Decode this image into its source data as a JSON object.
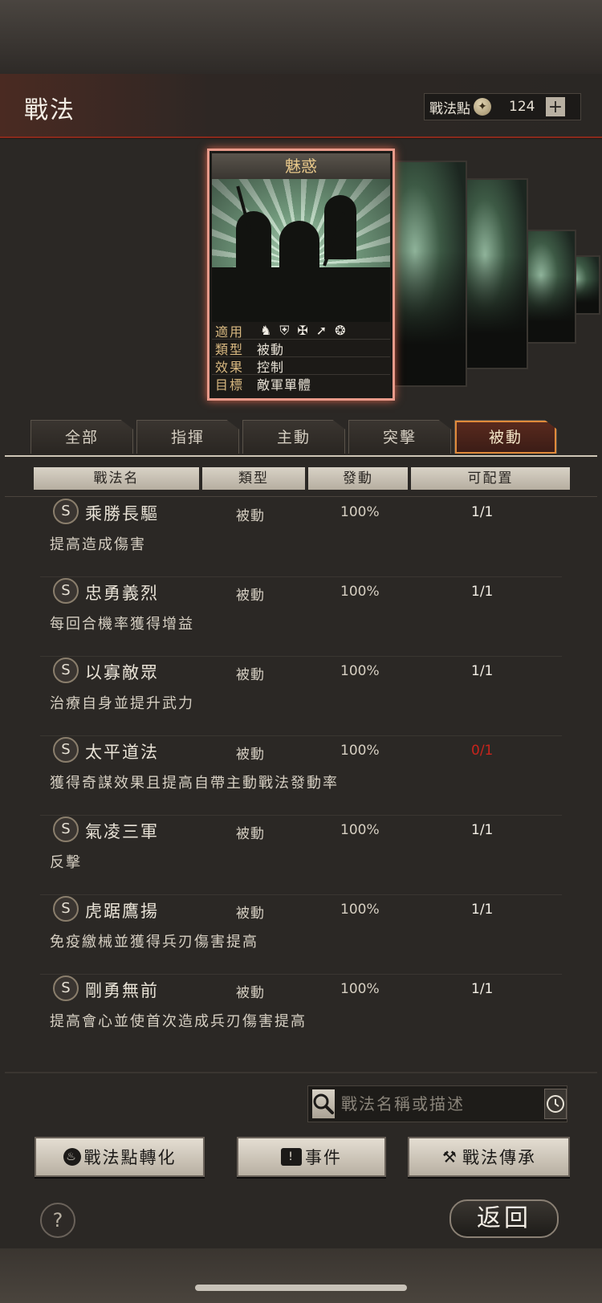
{
  "header": {
    "title": "戰法"
  },
  "points": {
    "label": "戰法點",
    "coin_icon": "coin-icon",
    "value": "124",
    "plus": "+"
  },
  "card": {
    "name": "魅惑",
    "props": [
      {
        "key": "適用",
        "value": ""
      },
      {
        "key": "類型",
        "value": "被動"
      },
      {
        "key": "效果",
        "value": "控制"
      },
      {
        "key": "目標",
        "value": "敵軍單體"
      }
    ],
    "unit_icons": [
      "cavalry-icon",
      "shield-icon",
      "bow-icon",
      "spear-icon",
      "siege-icon"
    ]
  },
  "tabs": [
    "全部",
    "指揮",
    "主動",
    "突擊",
    "被動"
  ],
  "active_tab": "被動",
  "columns": [
    "戰法名",
    "類型",
    "發動",
    "可配置"
  ],
  "tactics": [
    {
      "grade": "S",
      "name": "乘勝長驅",
      "type": "被動",
      "rate": "100%",
      "slots": "1/1",
      "desc": "提高造成傷害"
    },
    {
      "grade": "S",
      "name": "忠勇義烈",
      "type": "被動",
      "rate": "100%",
      "slots": "1/1",
      "desc": "每回合機率獲得增益"
    },
    {
      "grade": "S",
      "name": "以寡敵眾",
      "type": "被動",
      "rate": "100%",
      "slots": "1/1",
      "desc": "治療自身並提升武力"
    },
    {
      "grade": "S",
      "name": "太平道法",
      "type": "被動",
      "rate": "100%",
      "slots": "0/1",
      "desc": "獲得奇謀效果且提高自帶主動戰法發動率"
    },
    {
      "grade": "S",
      "name": "氣凌三軍",
      "type": "被動",
      "rate": "100%",
      "slots": "1/1",
      "desc": "反擊"
    },
    {
      "grade": "S",
      "name": "虎踞鷹揚",
      "type": "被動",
      "rate": "100%",
      "slots": "1/1",
      "desc": "免疫繳械並獲得兵刃傷害提高"
    },
    {
      "grade": "S",
      "name": "剛勇無前",
      "type": "被動",
      "rate": "100%",
      "slots": "1/1",
      "desc": "提高會心並使首次造成兵刃傷害提高"
    }
  ],
  "search": {
    "placeholder": "戰法名稱或描述"
  },
  "buttons": {
    "convert": "戰法點轉化",
    "event": "事件",
    "inherit": "戰法傳承"
  },
  "help": "?",
  "back": "返回",
  "colors": {
    "accent": "#e08a3a",
    "red": "#c8241c",
    "card_border": "#e89a8a"
  }
}
